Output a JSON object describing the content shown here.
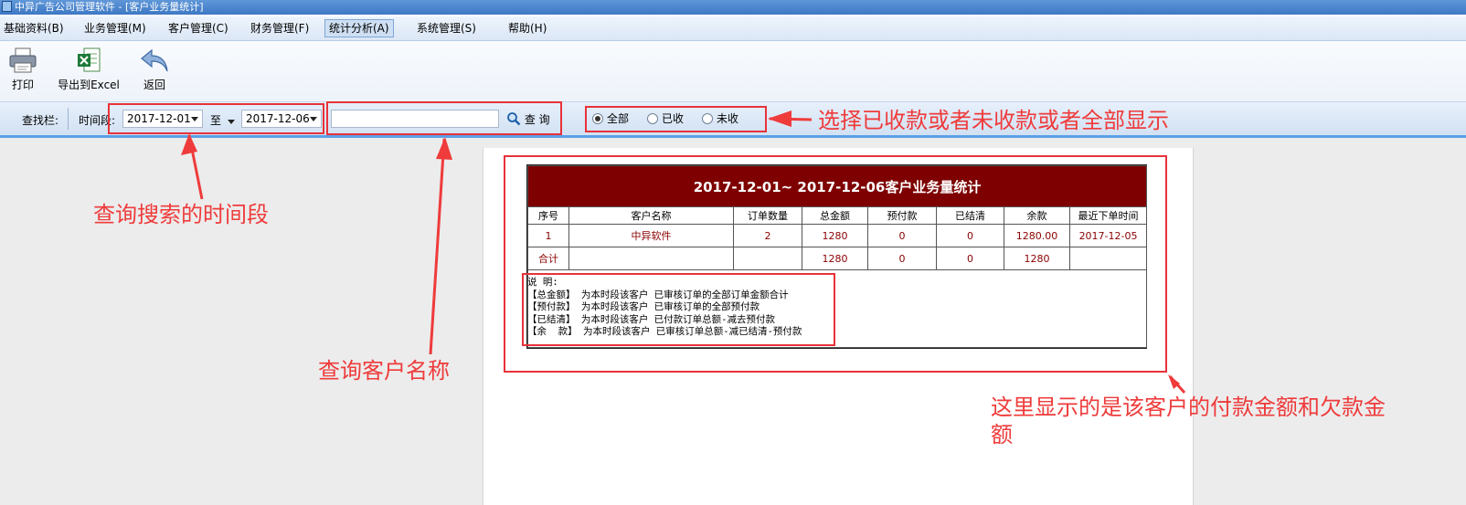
{
  "window": {
    "title": "中异广告公司管理软件 - [客户业务量统计]"
  },
  "menu": [
    {
      "label": "基础资料(B)"
    },
    {
      "label": "业务管理(M)"
    },
    {
      "label": "客户管理(C)"
    },
    {
      "label": "财务管理(F)"
    },
    {
      "label": "统计分析(A)",
      "active": true
    },
    {
      "label": "系统管理(S)"
    },
    {
      "label": "帮助(H)"
    }
  ],
  "toolbar": {
    "print": "打印",
    "export": "导出到Excel",
    "back": "返回"
  },
  "search": {
    "label": "查找栏:",
    "period_label": "时间段:",
    "date_from": "2017-12-01",
    "to_label": "至",
    "date_to": "2017-12-06",
    "customer_value": "",
    "query_label": "查 询",
    "filter_options": [
      {
        "label": "全部",
        "selected": true
      },
      {
        "label": "已收",
        "selected": false
      },
      {
        "label": "未收",
        "selected": false
      }
    ]
  },
  "report": {
    "title": "2017-12-01~ 2017-12-06客户业务量统计",
    "headers": [
      "序号",
      "客户名称",
      "订单数量",
      "总金额",
      "预付款",
      "已结清",
      "余款",
      "最近下单时间"
    ],
    "rows": [
      [
        "1",
        "中异软件",
        "2",
        "1280",
        "0",
        "0",
        "1280.00",
        "2017-12-05"
      ],
      [
        "合计",
        "",
        "",
        "1280",
        "0",
        "0",
        "1280",
        ""
      ]
    ],
    "notes": [
      "说 明:",
      "【总金额】 为本时段该客户 已审核订单的全部订单金额合计",
      "【预付款】 为本时段该客户 已审核订单的全部预付款",
      "【已结清】 为本时段该客户 已付款订单总额-减去预付款",
      "【余  款】 为本时段该客户 已审核订单总额-减已结清-预付款"
    ]
  },
  "annotations": {
    "filter": "选择已收款或者未收款或者全部显示",
    "period": "查询搜索的时间段",
    "customer": "查询客户名称",
    "report_line1": "这里显示的是该客户的付款金额和欠款金",
    "report_line2": "额"
  },
  "colors": {
    "annotation_red": "#e8323a",
    "report_title_bg": "#7e0000",
    "accent_blue": "#5aa0e8"
  }
}
